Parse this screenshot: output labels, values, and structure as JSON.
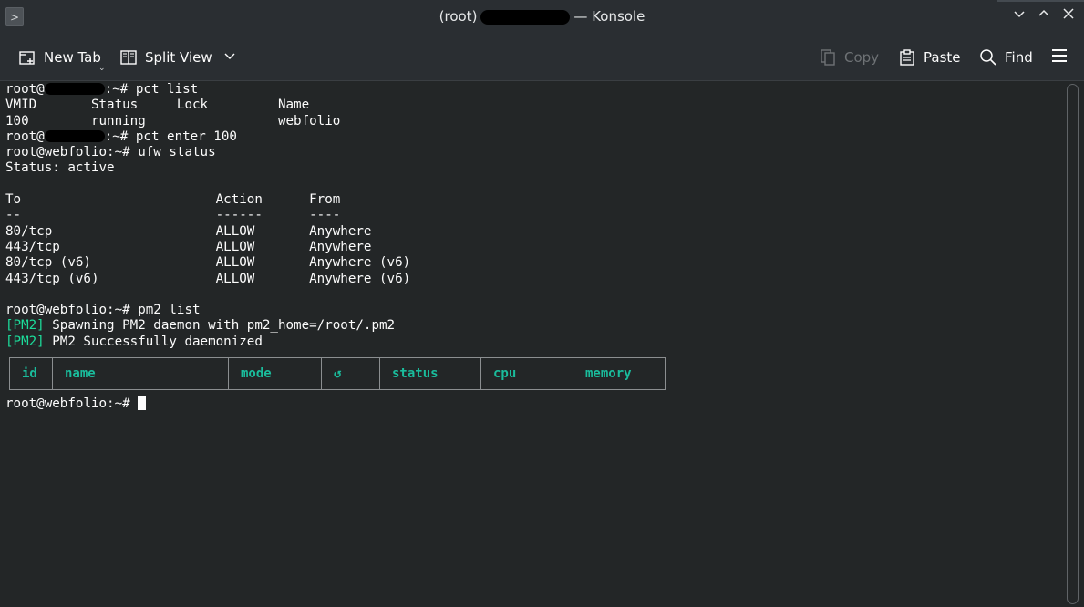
{
  "window": {
    "title_prefix": "(root)",
    "title_suffix": "— Konsole",
    "menu_icon": "chevron-right-icon",
    "controls": [
      "⌄",
      "⌃",
      "✕"
    ]
  },
  "toolbar": {
    "new_tab": "New Tab",
    "split_view": "Split View",
    "copy": "Copy",
    "paste": "Paste",
    "find": "Find"
  },
  "terminal": {
    "lines": [
      {
        "pre": "root@",
        "redacted": true,
        "post": ":~# pct list"
      },
      {
        "text": "VMID       Status     Lock         Name"
      },
      {
        "text": "100        running                 webfolio"
      },
      {
        "pre": "root@",
        "redacted": true,
        "post": ":~# pct enter 100"
      },
      {
        "text": "root@webfolio:~# ufw status"
      },
      {
        "text": "Status: active"
      },
      {
        "text": ""
      },
      {
        "text": "To                         Action      From"
      },
      {
        "text": "--                         ------      ----"
      },
      {
        "text": "80/tcp                     ALLOW       Anywhere"
      },
      {
        "text": "443/tcp                    ALLOW       Anywhere"
      },
      {
        "text": "80/tcp (v6)                ALLOW       Anywhere (v6)"
      },
      {
        "text": "443/tcp (v6)               ALLOW       Anywhere (v6)"
      },
      {
        "text": ""
      },
      {
        "text": "root@webfolio:~# pm2 list"
      },
      {
        "tag": "[PM2]",
        "text": " Spawning PM2 daemon with pm2_home=/root/.pm2"
      },
      {
        "tag": "[PM2]",
        "text": " PM2 Successfully daemonized"
      }
    ],
    "pm2_table_headers": [
      "id",
      "name",
      "mode",
      "↺",
      "status",
      "cpu",
      "memory"
    ],
    "final_prompt": "root@webfolio:~# "
  },
  "colors": {
    "background": "#232627",
    "pm2_green": "#1cdc9a",
    "table_header": "#1abc9c"
  }
}
